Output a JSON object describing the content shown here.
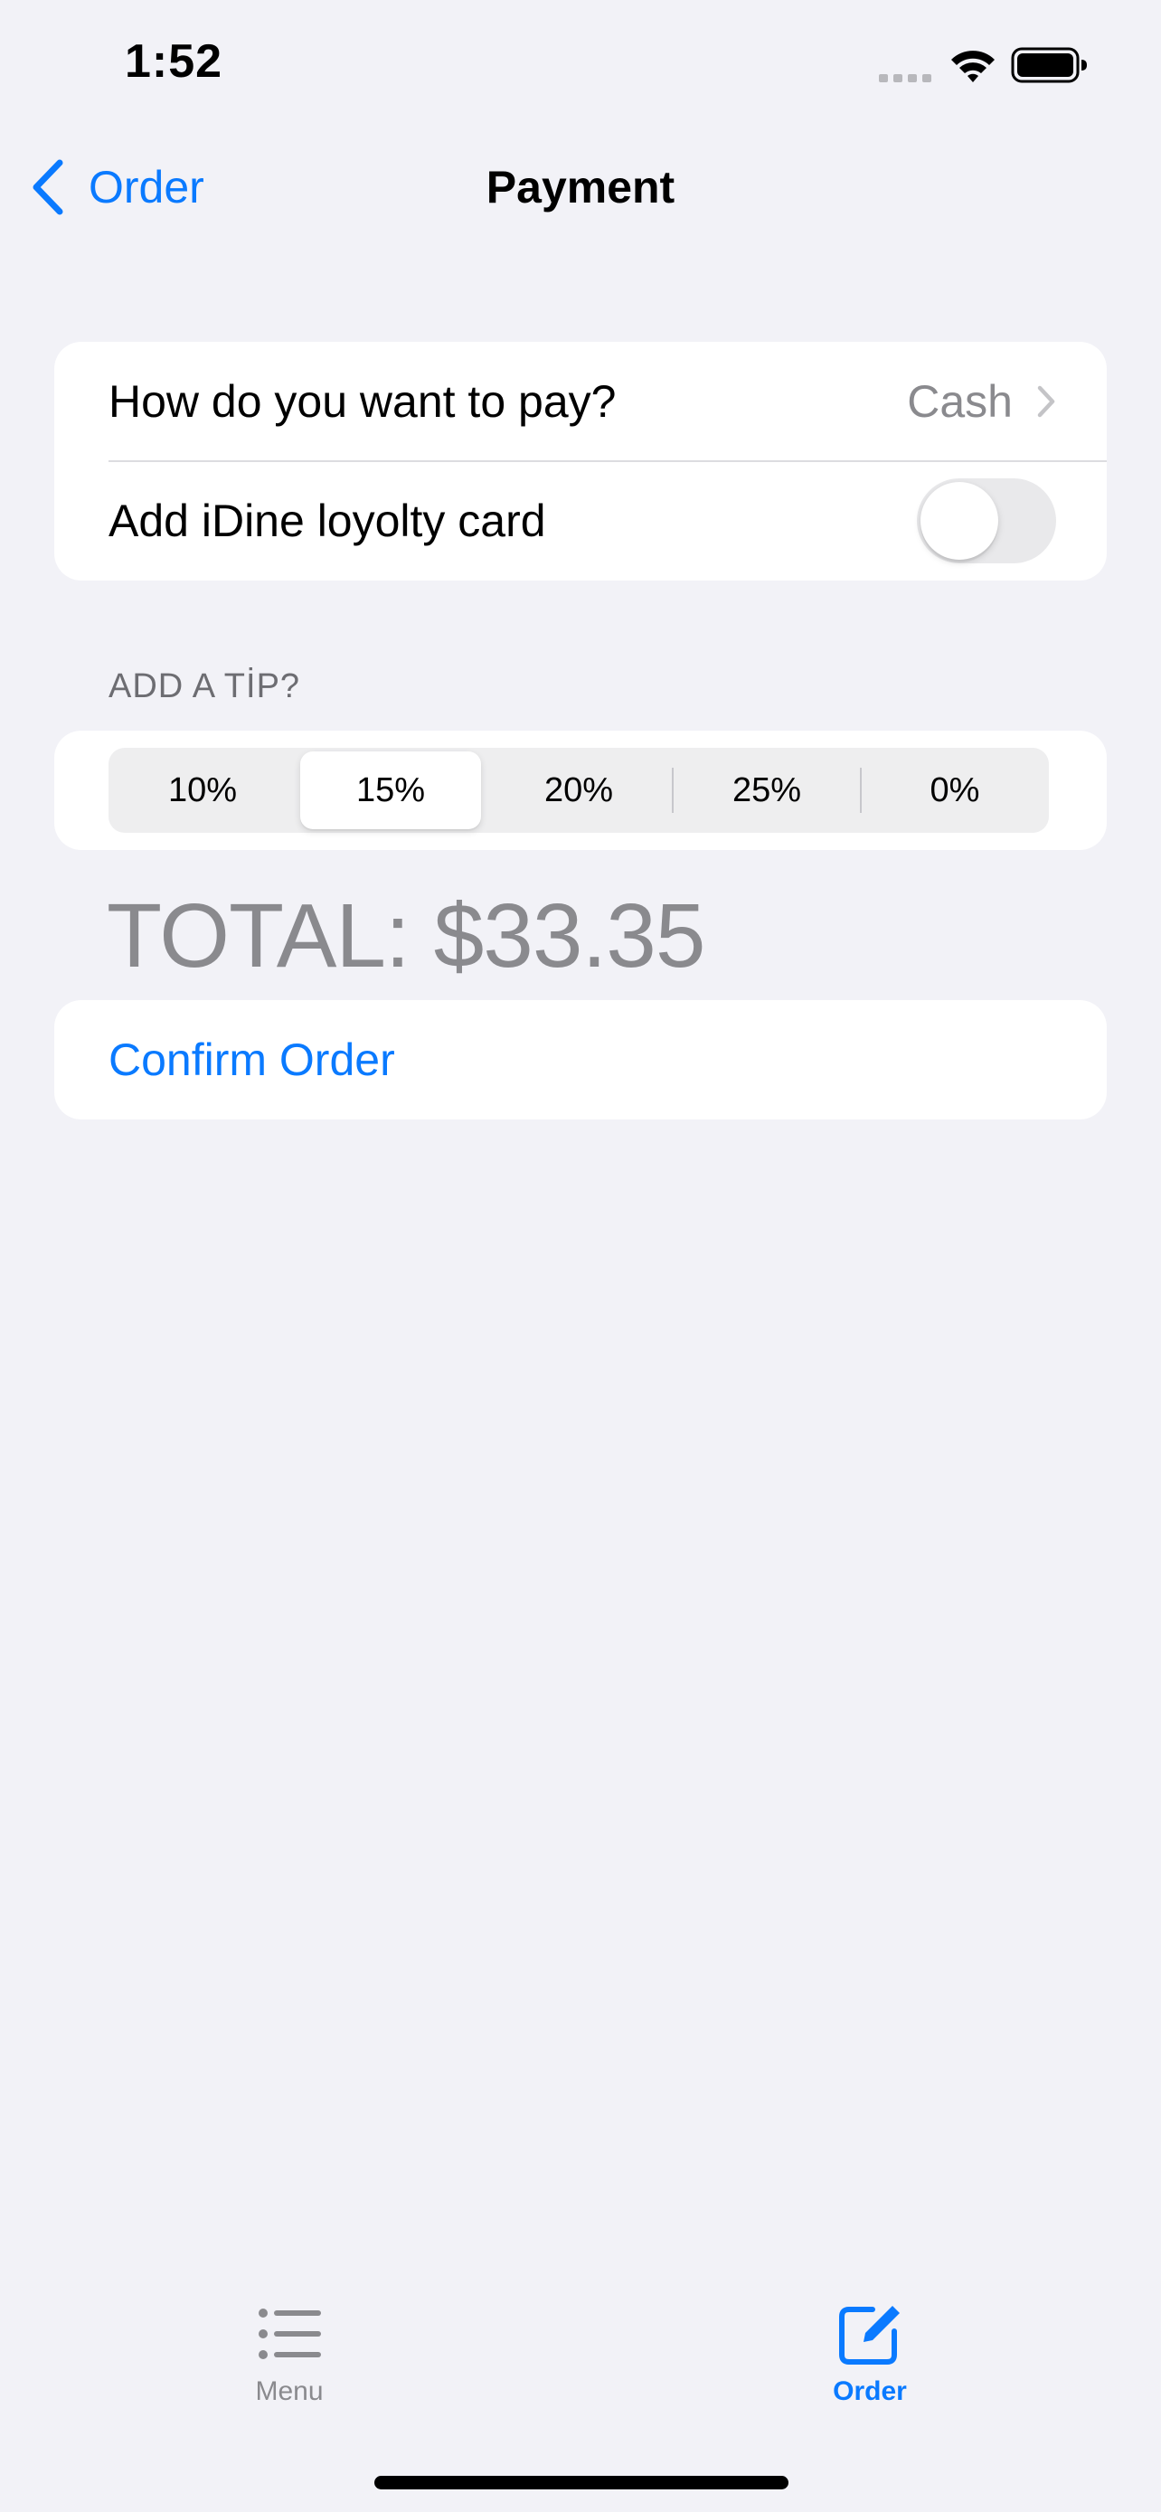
{
  "status_bar": {
    "time": "1:52"
  },
  "nav": {
    "back_label": "Order",
    "title": "Payment"
  },
  "payment": {
    "method_label": "How do you want to pay?",
    "method_value": "Cash",
    "loyalty_label": "Add iDine loyolty card",
    "loyalty_enabled": false
  },
  "tip": {
    "header": "ADD A TİP?",
    "options": [
      "10%",
      "15%",
      "20%",
      "25%",
      "0%"
    ],
    "selected": "15%"
  },
  "total": {
    "text": "TOTAL: $33.35"
  },
  "confirm": {
    "label": "Confirm Order"
  },
  "tab_bar": {
    "items": [
      {
        "label": "Menu",
        "icon": "list-icon",
        "selected": false
      },
      {
        "label": "Order",
        "icon": "square-pencil-icon",
        "selected": true
      }
    ]
  },
  "colors": {
    "accent": "#0a7aff",
    "background": "#f2f2f7",
    "secondary_text": "#8a8a8e"
  }
}
